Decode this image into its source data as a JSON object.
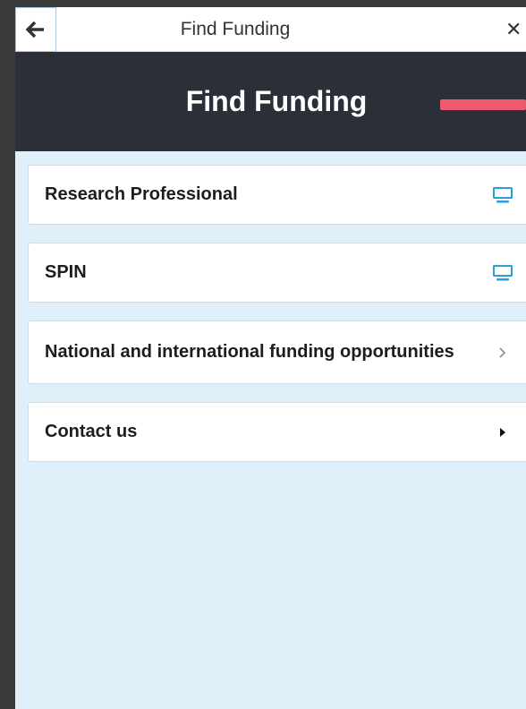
{
  "topbar": {
    "title": "Find Funding"
  },
  "header": {
    "title": "Find Funding"
  },
  "colors": {
    "accent": "#f0586e",
    "desktop_icon": "#2a9fd8",
    "header_bg": "#2b2f37",
    "content_bg": "#dff0fb"
  },
  "items": [
    {
      "label": "Research Professional",
      "icon": "desktop-icon"
    },
    {
      "label": "SPIN",
      "icon": "desktop-icon"
    },
    {
      "label": "National and international funding opportunities",
      "icon": "chevron-right-icon"
    },
    {
      "label": "Contact us",
      "icon": "caret-right-icon"
    }
  ]
}
